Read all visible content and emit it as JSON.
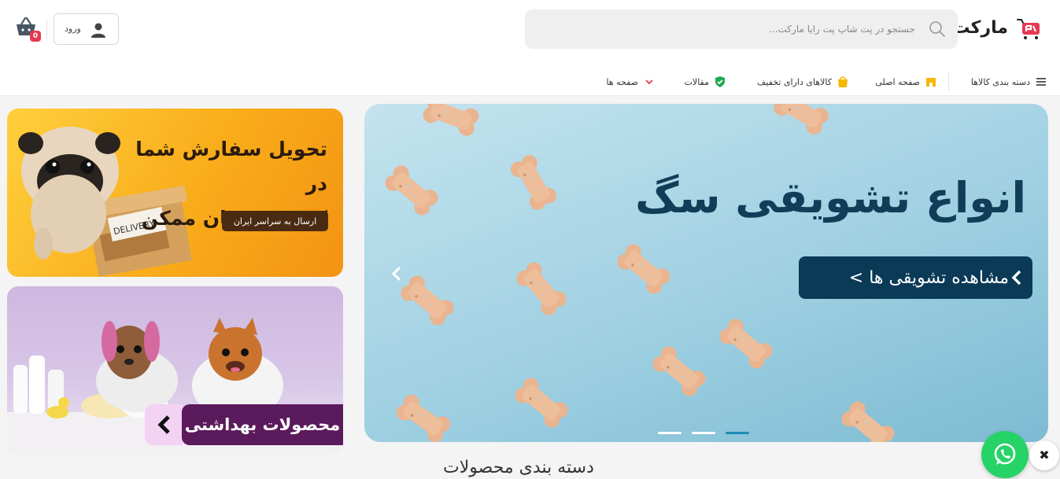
{
  "header": {
    "logo_text": "مارکت",
    "search": {
      "placeholder": "جستجو در پت شاپ پت رایا مارکت..."
    },
    "login_label": "ورود",
    "cart_count": "0"
  },
  "nav": {
    "items": [
      {
        "label": "دسته بندی کالاها",
        "icon": "menu-icon"
      },
      {
        "label": "صفحه اصلی",
        "icon": "store-icon"
      },
      {
        "label": "کالاهای دارای تخفیف",
        "icon": "shopping-bag-icon"
      },
      {
        "label": "مقالات",
        "icon": "shield-check-icon"
      },
      {
        "label": "صفحه ها",
        "icon": "chevron-down-icon"
      }
    ]
  },
  "slider": {
    "title": "انواع تشویقی سگ",
    "cta": "مشاهده تشویقی ها >",
    "slide_count": 3,
    "active_slide": 3
  },
  "banners": {
    "delivery": {
      "title_line1": "تحویل سفارش شما در",
      "title_line2": "کمترین زمان ممکن",
      "pill": "ارسال به سراسر ایران",
      "box_label": "DELIVERY"
    },
    "hygiene": {
      "label": "محصولات بهداشتی"
    }
  },
  "section": {
    "title": "دسته بندی محصولات"
  },
  "colors": {
    "accent_red": "#e53950",
    "slider_navy": "#0b3a57",
    "whatsapp_green": "#25d366",
    "delivery_orange": "#f9ac1a",
    "hygiene_purple": "#5b1a5c"
  },
  "floating": {
    "whatsapp_icon": "whatsapp-icon",
    "close_glyph": "✖"
  }
}
